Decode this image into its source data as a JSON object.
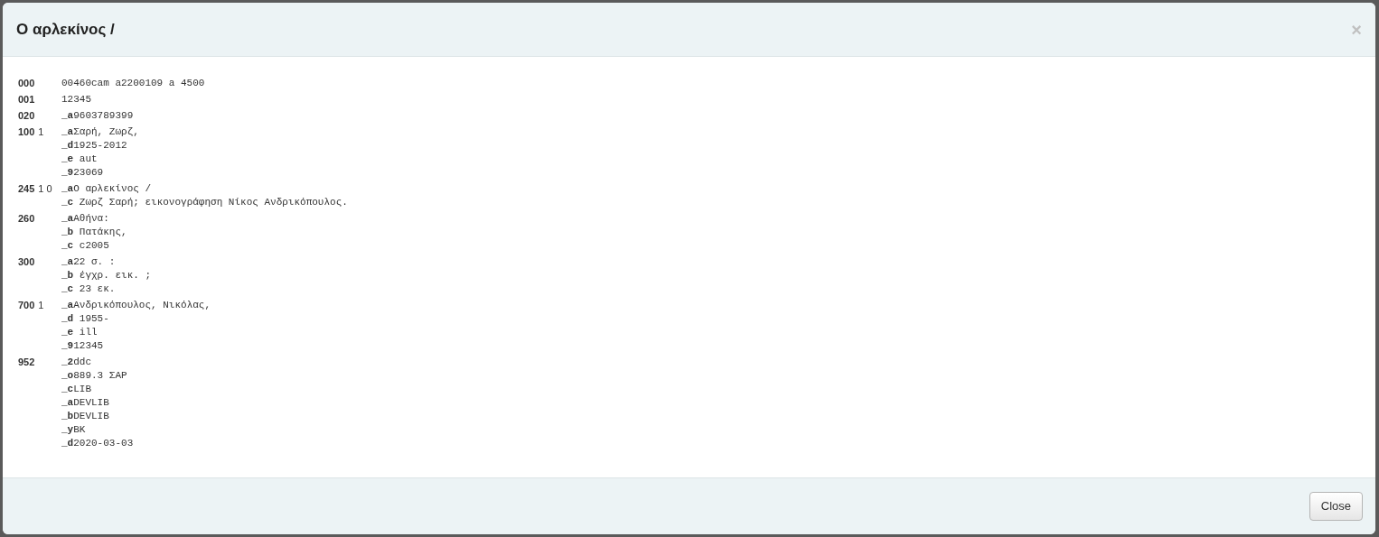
{
  "modal": {
    "title": "Ο αρλεκίνος /",
    "close_icon": "×",
    "button": "Close"
  },
  "fields": [
    {
      "tag": "000",
      "value": "00460cam a2200109 a 4500"
    },
    {
      "tag": "001",
      "value": "12345"
    },
    {
      "tag": "020",
      "subfields": [
        "_**a**9603789399"
      ]
    },
    {
      "tag": "100",
      "indicators": "1",
      "subfields": [
        "_**a**Σαρή, Ζωρζ,",
        "_**d**1925-2012",
        "_**e** aut",
        "_**9**23069"
      ]
    },
    {
      "tag": "245",
      "indicators": "1 0",
      "subfields": [
        "_**a**Ο αρλεκίνος /",
        "_**c** Ζωρζ Σαρή; εικονογράφηση Νίκος Ανδρικόπουλος."
      ]
    },
    {
      "tag": "260",
      "subfields": [
        "_**a**Αθήνα:",
        "_**b** Πατάκης,",
        "_**c** c2005"
      ]
    },
    {
      "tag": "300",
      "subfields": [
        "_**a**22 σ. :",
        "_**b** έγχρ. εικ. ;",
        "_**c** 23 εκ."
      ]
    },
    {
      "tag": "700",
      "indicators": "1",
      "subfields": [
        "_**a**Ανδρικόπουλος, Νικόλας,",
        "_**d** 1955-",
        "_**e** ill",
        "_**9**12345"
      ]
    },
    {
      "tag": "952",
      "subfields": [
        "_**2**ddc",
        "_**o**889.3 ΣΑΡ",
        "_**c**LIB",
        "_**a**DEVLIB",
        "_**b**DEVLIB",
        "_**y**BK",
        "_**d**2020-03-03"
      ]
    }
  ]
}
